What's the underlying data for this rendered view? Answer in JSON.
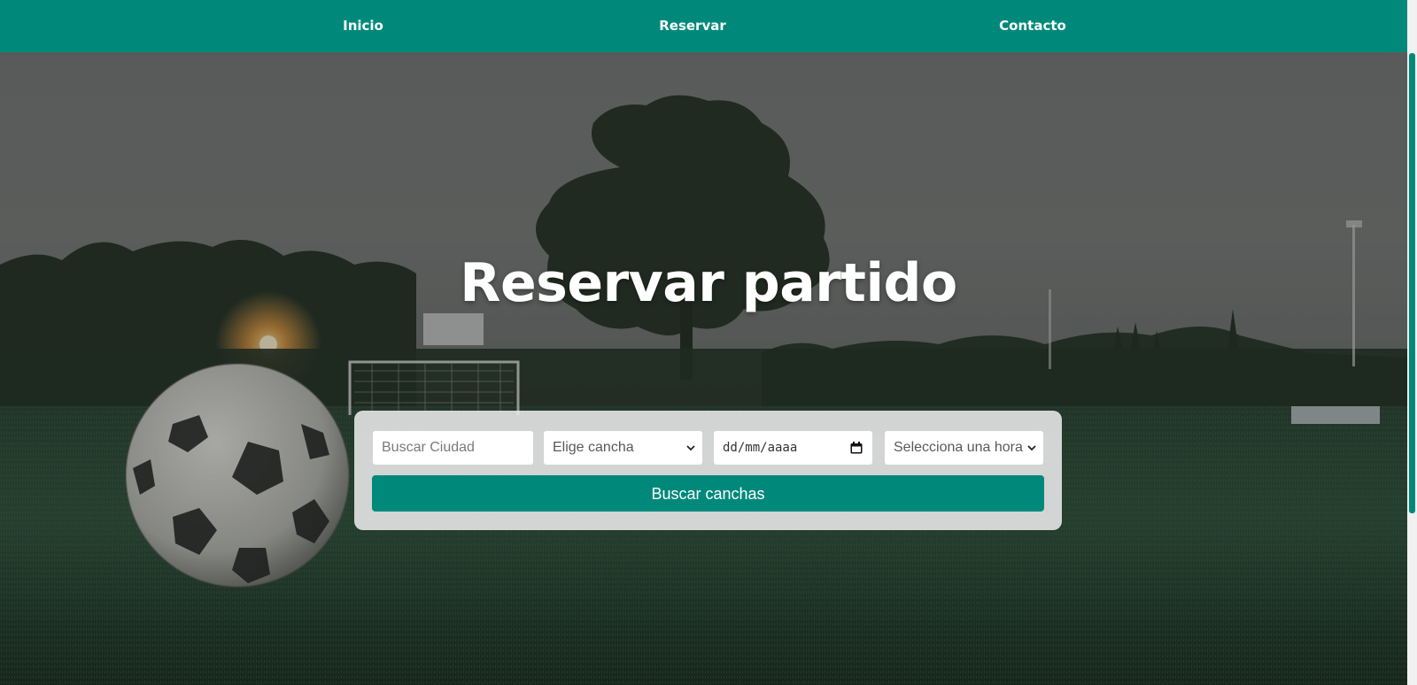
{
  "nav": {
    "items": [
      {
        "label": "Inicio"
      },
      {
        "label": "Reservar"
      },
      {
        "label": "Contacto"
      }
    ]
  },
  "hero": {
    "title": "Reservar partido"
  },
  "search": {
    "city": {
      "placeholder": "Buscar Ciudad",
      "value": ""
    },
    "court": {
      "selected": "Elige cancha"
    },
    "date": {
      "value": "dd/mm/aaaa"
    },
    "time": {
      "selected": "Selecciona una hora"
    },
    "button_label": "Buscar canchas"
  },
  "colors": {
    "brand": "#00897b",
    "text_light": "#ffffff"
  },
  "icons": {
    "court_select": "chevron-down-icon",
    "time_select": "chevron-down-icon",
    "date_picker": "calendar-icon"
  }
}
